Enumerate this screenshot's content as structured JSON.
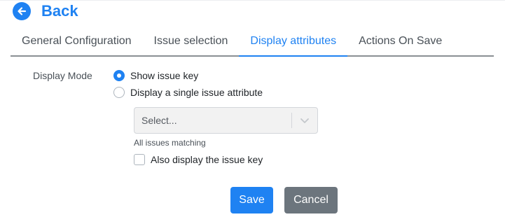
{
  "header": {
    "back_label": "Back",
    "back_icon": "arrow-left-circle-icon"
  },
  "tabs": [
    {
      "label": "General Configuration",
      "active": false
    },
    {
      "label": "Issue selection",
      "active": false
    },
    {
      "label": "Display attributes",
      "active": true
    },
    {
      "label": "Actions On Save",
      "active": false
    }
  ],
  "form": {
    "display_mode_label": "Display Mode",
    "options": [
      {
        "label": "Show issue key",
        "checked": true
      },
      {
        "label": "Display a single issue attribute",
        "checked": false
      }
    ],
    "attribute_select": {
      "placeholder": "Select...",
      "icon": "chevron-down-icon"
    },
    "help_text": "All issues matching",
    "also_display_key": {
      "label": "Also display the issue key",
      "checked": false
    }
  },
  "buttons": {
    "save": "Save",
    "cancel": "Cancel"
  },
  "colors": {
    "primary": "#1f82f2",
    "secondary": "#6c757d"
  }
}
